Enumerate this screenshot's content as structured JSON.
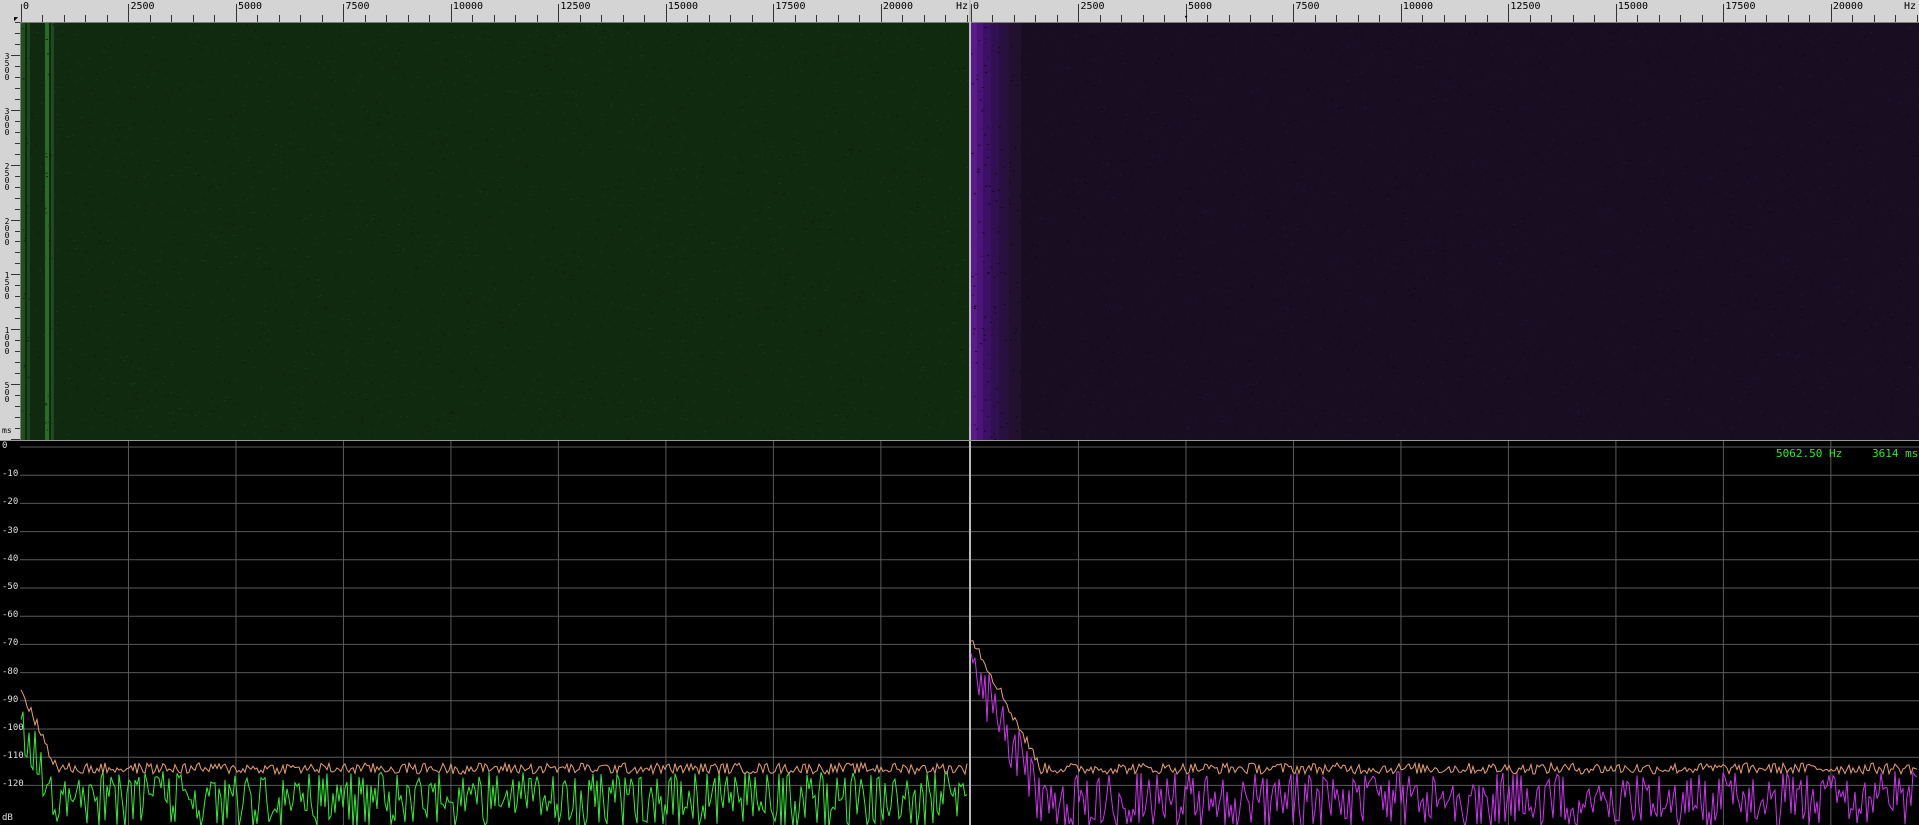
{
  "freq_ruler": {
    "left_labels": [
      "0",
      "2500",
      "5000",
      "7500",
      "10000",
      "12500",
      "15000",
      "17500",
      "20000"
    ],
    "right_labels": [
      "0",
      "2500",
      "5000",
      "7500",
      "10000",
      "12500",
      "15000",
      "17500",
      "20000"
    ],
    "unit": "Hz"
  },
  "time_ruler": {
    "labels": [
      "3500",
      "3000",
      "2500",
      "2000",
      "1500",
      "1000",
      "500"
    ],
    "unit": "ms"
  },
  "analyzer": {
    "db_labels": [
      "0",
      "-10",
      "-20",
      "-30",
      "-40",
      "-50",
      "-60",
      "-70",
      "-80",
      "-90",
      "-100",
      "-110",
      "-120"
    ],
    "db_unit": "dB",
    "cursor_freq": "5062.50 Hz",
    "cursor_time": "3614 ms"
  },
  "colors": {
    "channel_left": "#33ee33",
    "channel_right": "#cc33ee",
    "peak_trace": "#e8a070",
    "grid": "#5a5a5a",
    "readout": "#2ee82e"
  }
}
